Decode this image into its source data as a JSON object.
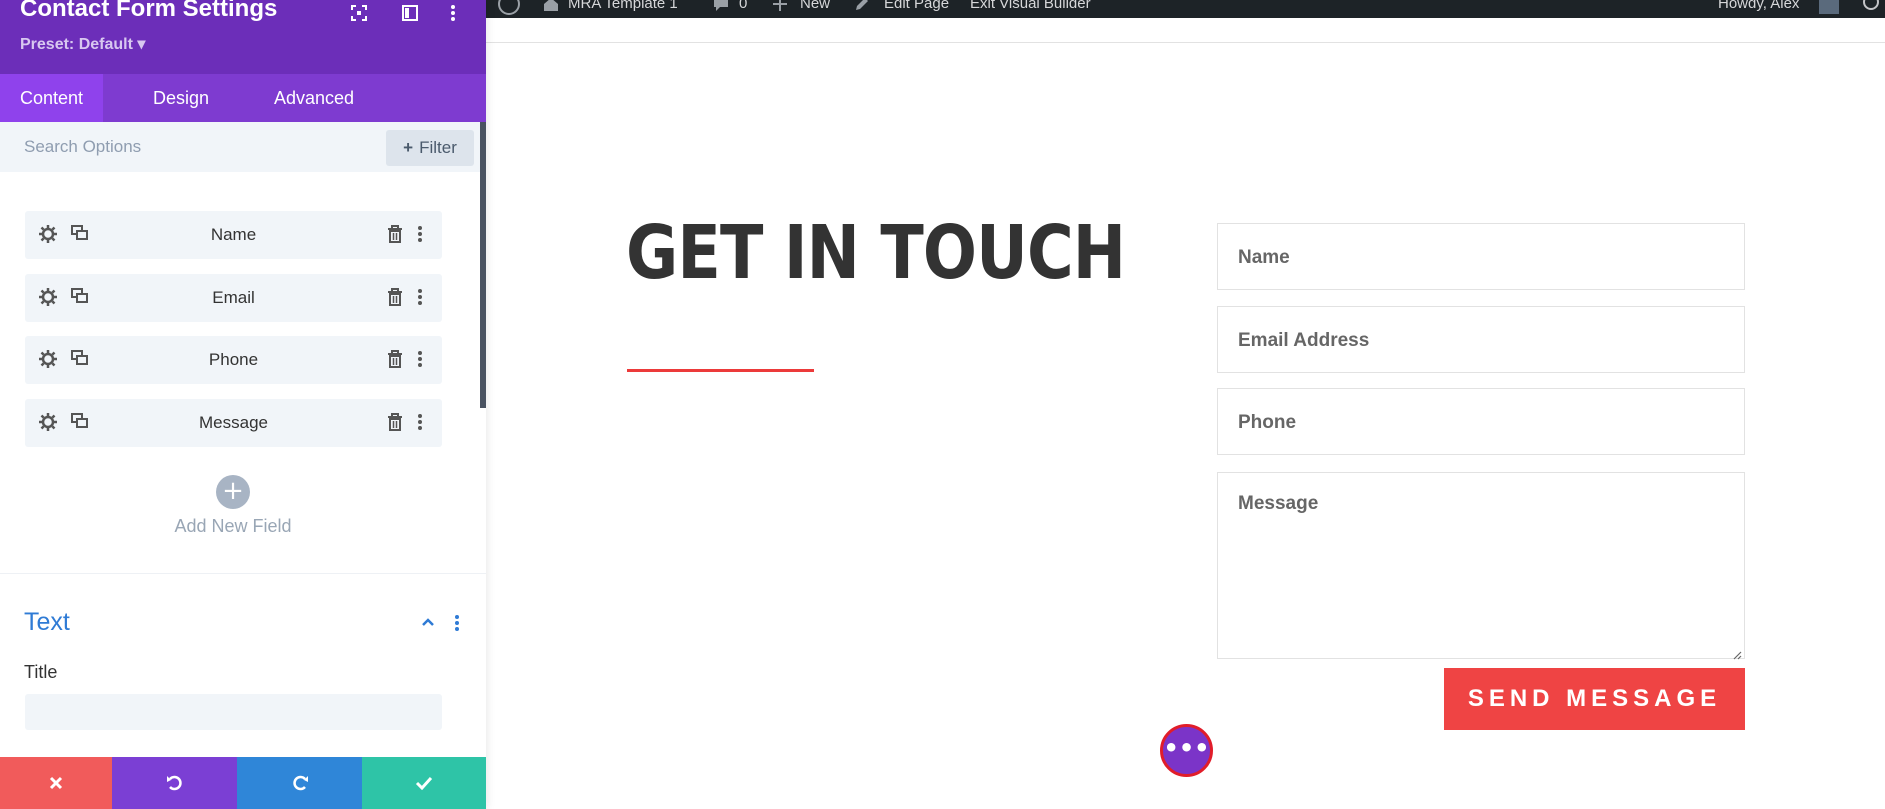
{
  "admin_bar": {
    "site_name": "MRA Template 1",
    "comments_count": "0",
    "new_label": "New",
    "edit_page_label": "Edit Page",
    "exit_builder_label": "Exit Visual Builder",
    "howdy_label": "Howdy, Alex"
  },
  "panel": {
    "title": "Contact Form Settings",
    "preset_label": "Preset: Default ▾",
    "tabs": [
      {
        "label": "Content",
        "active": true
      },
      {
        "label": "Design",
        "active": false
      },
      {
        "label": "Advanced",
        "active": false
      }
    ],
    "search_placeholder": "Search Options",
    "filter_label": "Filter",
    "fields": [
      {
        "label": "Name"
      },
      {
        "label": "Email"
      },
      {
        "label": "Phone"
      },
      {
        "label": "Message"
      }
    ],
    "add_field_label": "Add New Field",
    "section_title": "Text",
    "title_field_label": "Title",
    "title_field_value": ""
  },
  "bottom_bar": {
    "colors": {
      "cancel": "#f15b5b",
      "undo": "#7b3fd4",
      "redo": "#2f86d8",
      "save": "#2ec4a7"
    }
  },
  "canvas": {
    "heading": "GET IN TOUCH",
    "form_fields": [
      {
        "placeholder": "Name"
      },
      {
        "placeholder": "Email Address"
      },
      {
        "placeholder": "Phone"
      }
    ],
    "message_placeholder": "Message",
    "submit_label": "SEND MESSAGE",
    "fab_label": "•••"
  },
  "colors": {
    "panel_header": "#6c2eb9",
    "tabs_bar": "#7e3bd0",
    "active_tab": "#8f42ec",
    "accent_red": "#ef4444",
    "section_blue": "#2f7bd5"
  }
}
